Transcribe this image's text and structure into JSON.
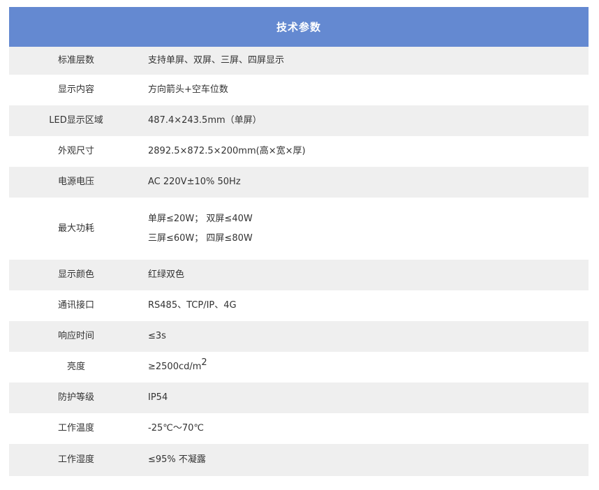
{
  "title": "技术参数",
  "rows": [
    {
      "label": "标准层数",
      "lines": [
        "支持单屏、双屏、三屏、四屏显示"
      ]
    },
    {
      "label": "显示内容",
      "lines": [
        "方向箭头+空车位数"
      ]
    },
    {
      "label": "LED显示区域",
      "lines": [
        "487.4×243.5mm（单屏）"
      ]
    },
    {
      "label": "外观尺寸",
      "lines": [
        "2892.5×872.5×200mm(高×宽×厚)"
      ]
    },
    {
      "label": "电源电压",
      "lines": [
        "AC 220V±10% 50Hz"
      ]
    },
    {
      "label": "最大功耗",
      "lines": [
        "单屏≤20W；  双屏≤40W",
        "三屏≤60W；  四屏≤80W"
      ]
    },
    {
      "label": "显示颜色",
      "lines": [
        "红绿双色"
      ]
    },
    {
      "label": "通讯接口",
      "lines": [
        "RS485、TCP/IP、4G"
      ]
    },
    {
      "label": "响应时间",
      "lines": [
        "≤3s"
      ]
    },
    {
      "label": "亮度",
      "lines": [
        "≥2500cd/m"
      ],
      "sup": "2"
    },
    {
      "label": "防护等级",
      "lines": [
        "IP54"
      ]
    },
    {
      "label": "工作温度",
      "lines": [
        "-25℃～70℃"
      ]
    },
    {
      "label": "工作湿度",
      "lines": [
        "≤95% 不凝露"
      ]
    }
  ],
  "colors": {
    "header_bg": "#6489d1",
    "row_shaded": "#efefef",
    "row_plain": "#ffffff",
    "text": "#333333"
  }
}
